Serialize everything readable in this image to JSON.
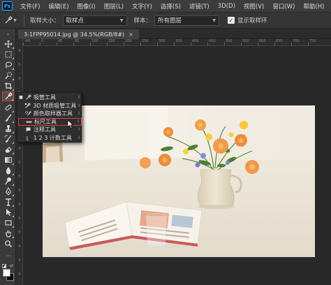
{
  "app": {
    "logo": "Ps"
  },
  "menu": [
    {
      "label": "文件(F)"
    },
    {
      "label": "编辑(E)"
    },
    {
      "label": "图像(I)"
    },
    {
      "label": "图层(L)"
    },
    {
      "label": "文字(Y)"
    },
    {
      "label": "选择(S)"
    },
    {
      "label": "滤镜(T)"
    },
    {
      "label": "3D(D)"
    },
    {
      "label": "视图(V)"
    },
    {
      "label": "窗口(W)"
    },
    {
      "label": "帮助(H)"
    }
  ],
  "options": {
    "sample_size_label": "取样大小：",
    "sample_size_value": "取样点",
    "sample_label": "样本：",
    "sample_value": "所有图层",
    "show_ring_label": "显示取样环",
    "show_ring_checked": true
  },
  "tab": {
    "title": "3-1FPP95014.jpg @ 34.5%(RGB/8#)",
    "close": "×"
  },
  "ruler_h": [
    "-40",
    "0",
    "40",
    "60",
    "100",
    "150",
    "200",
    "250",
    "300",
    "350",
    "400",
    "450",
    "500",
    "550",
    "600",
    "650",
    "700",
    "750"
  ],
  "ruler_v": [
    "4",
    "5",
    "0",
    "5",
    "0",
    "1",
    "5",
    "0",
    "2",
    "5",
    "0",
    "3",
    "5",
    "0",
    "4",
    "5",
    "0"
  ],
  "flyout": {
    "items": [
      {
        "label": "吸管工具",
        "key": "I",
        "icon": "eyedropper-icon",
        "active": true
      },
      {
        "label": "3D 材质吸管工具",
        "key": "I",
        "icon": "3d-eyedropper-icon",
        "active": false
      },
      {
        "label": "颜色取样器工具",
        "key": "I",
        "icon": "color-sampler-icon",
        "active": false
      },
      {
        "label": "标尺工具",
        "key": "I",
        "icon": "ruler-icon",
        "active": false
      },
      {
        "label": "注释工具",
        "key": "I",
        "icon": "note-icon",
        "active": false
      },
      {
        "label": "1 2 3 计数工具",
        "key": "I",
        "icon": "count-icon",
        "active": false
      }
    ]
  },
  "colors": {
    "foreground": "#ffffff",
    "background": "#0a0a0a",
    "highlight": "#e13a3a"
  }
}
